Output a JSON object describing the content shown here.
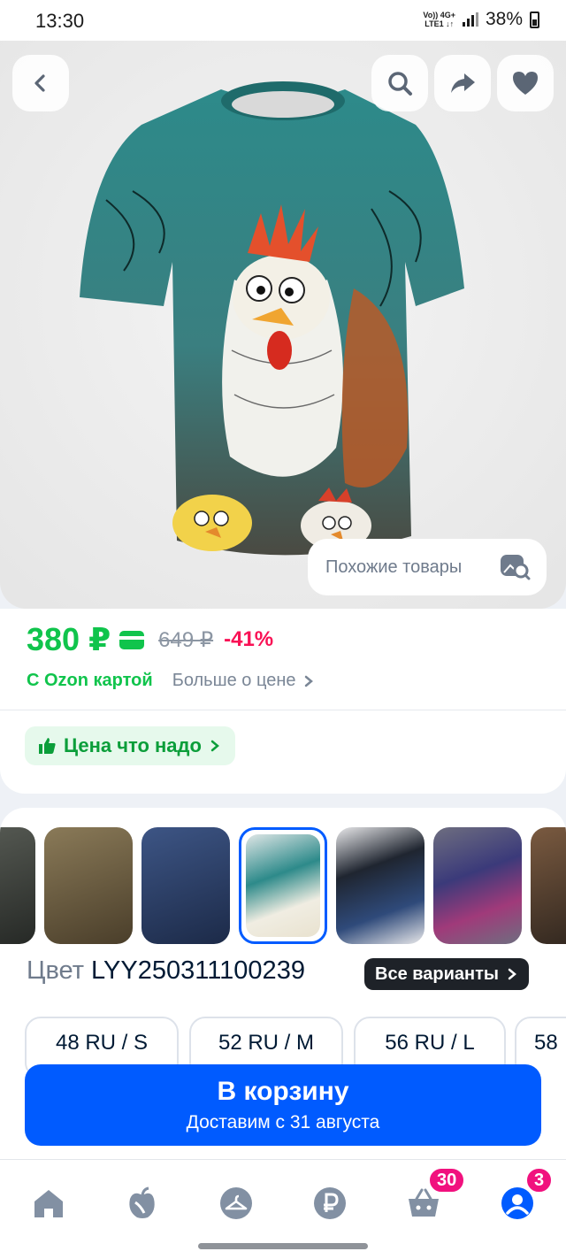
{
  "status_bar": {
    "time": "13:30",
    "network_top": "Vo)) 4G+",
    "network_bottom": "LTE1 ↓↑",
    "battery": "38%"
  },
  "hero": {
    "similar_label": "Похожие товары"
  },
  "price": {
    "current": "380 ₽",
    "old": "649 ₽",
    "discount": "-41%",
    "ozon_card_label": "С Ozon картой",
    "more_label": "Больше о цене"
  },
  "badge": {
    "label": "Цена что надо"
  },
  "variants": {
    "color_label": "Цвет",
    "color_value": "LYY250311100239",
    "all_variants_label": "Все варианты",
    "sizes": [
      "48 RU / S",
      "52 RU / M",
      "56 RU / L",
      "58"
    ],
    "thumbnail_colors": [
      "#3a3f3b",
      "#6b5a3e",
      "#2b3d63",
      "#2d8a8a",
      "#1f2530",
      "#3b3a7a",
      "#4a3a30"
    ],
    "selected_index": 3
  },
  "cart": {
    "button_label": "В корзину",
    "delivery_label": "Доставим с 31 августа"
  },
  "bottom_nav": {
    "cart_badge": "30",
    "profile_badge": "3"
  },
  "colors": {
    "accent": "#005bff",
    "price_green": "#10c44c",
    "discount": "#f91155",
    "badge_pink": "#f1117e"
  }
}
